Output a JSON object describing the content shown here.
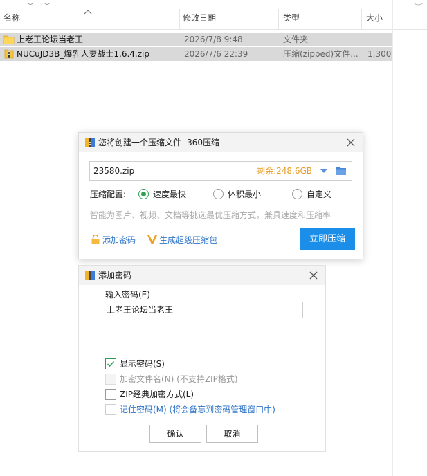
{
  "explorer": {
    "columns": [
      {
        "id": "name",
        "label": "名称"
      },
      {
        "id": "date",
        "label": "修改日期"
      },
      {
        "id": "type",
        "label": "类型"
      },
      {
        "id": "size",
        "label": "大小"
      }
    ],
    "files": [
      {
        "name": "上老王论坛当老王",
        "date": "2026/7/8 9:48",
        "type": "文件夹",
        "size": "",
        "icon": "folder-icon"
      },
      {
        "name": "NUCuJD3B_爆乳人妻战士1.6.4.zip",
        "date": "2026/7/6 22:39",
        "type": "压缩(zipped)文件...",
        "size": "1,300,",
        "icon": "zip-file-icon"
      }
    ]
  },
  "compress_dialog": {
    "title": "您将创建一个压缩文件 -360压缩",
    "filename": "23580.zip",
    "remaining": "剩余:248.6GB",
    "config_label": "压缩配置:",
    "options": [
      {
        "label": "速度最快",
        "selected": true
      },
      {
        "label": "体积最小",
        "selected": false
      },
      {
        "label": "自定义",
        "selected": false
      }
    ],
    "hint": "智能为图片、视频、文档等挑选最优压缩方式，兼具速度和压缩率",
    "add_password_label": "添加密码",
    "super_package_label": "生成超级压缩包",
    "compress_button": "立即压缩",
    "colors": {
      "primary": "#1a8ee8",
      "accent": "#e89b22",
      "link": "#2f74c7",
      "radio": "#2e9e55"
    }
  },
  "password_dialog": {
    "title": "添加密码",
    "input_label": "输入密码(E)",
    "password_value": "上老王论坛当老王",
    "options": [
      {
        "label": "显示密码(S)",
        "checked": true,
        "disabled": false
      },
      {
        "label": "加密文件名(N) (不支持ZIP格式)",
        "checked": false,
        "disabled": true
      },
      {
        "label": "ZIP经典加密方式(L)",
        "checked": false,
        "disabled": false
      },
      {
        "label": "记住密码(M) (将会备忘到密码管理窗口中)",
        "checked": false,
        "disabled": false
      }
    ],
    "ok_button": "确认",
    "cancel_button": "取消"
  }
}
